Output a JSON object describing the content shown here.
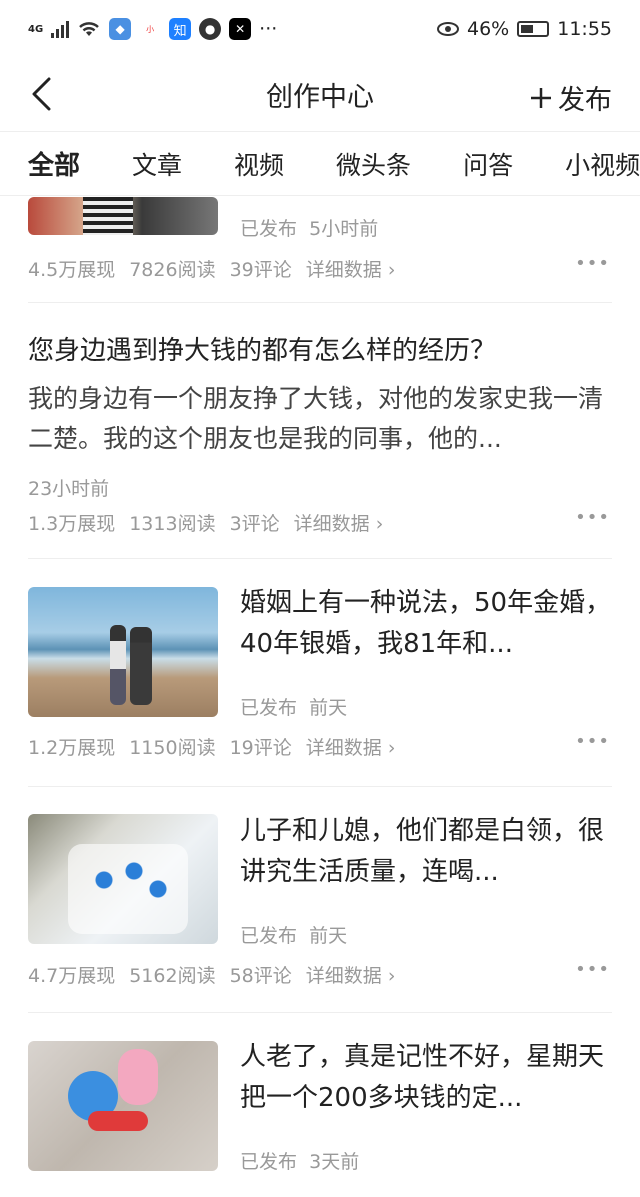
{
  "status": {
    "network": "4G",
    "battery": "46%",
    "time": "11:55",
    "app_icons": [
      "weibo-icon",
      "xiaohongshu-icon",
      "zhihu-icon",
      "toutiao-icon",
      "capcut-icon"
    ],
    "more": "···"
  },
  "header": {
    "title": "创作中心",
    "publish_label": "发布"
  },
  "tabs": [
    "全部",
    "文章",
    "视频",
    "微头条",
    "问答",
    "小视频"
  ],
  "items": [
    {
      "published": "已发布",
      "time": "5小时前",
      "views": "4.5万展现",
      "reads": "7826阅读",
      "comments": "39评论",
      "detail": "详细数据"
    },
    {
      "title": "您身边遇到挣大钱的都有怎么样的经历？",
      "summary": "我的身边有一个朋友挣了大钱，对他的发家史我一清二楚。我的这个朋友也是我的同事，他的...",
      "time": "23小时前",
      "views": "1.3万展现",
      "reads": "1313阅读",
      "comments": "3评论",
      "detail": "详细数据"
    },
    {
      "text": "婚姻上有一种说法，50年金婚，40年银婚，我81年和...",
      "published": "已发布",
      "time": "前天",
      "views": "1.2万展现",
      "reads": "1150阅读",
      "comments": "19评论",
      "detail": "详细数据"
    },
    {
      "text": "儿子和儿媳，他们都是白领，很讲究生活质量，连喝...",
      "published": "已发布",
      "time": "前天",
      "views": "4.7万展现",
      "reads": "5162阅读",
      "comments": "58评论",
      "detail": "详细数据"
    },
    {
      "text": "人老了，真是记性不好，星期天把一个200多块钱的定...",
      "published": "已发布",
      "time": "3天前"
    }
  ]
}
